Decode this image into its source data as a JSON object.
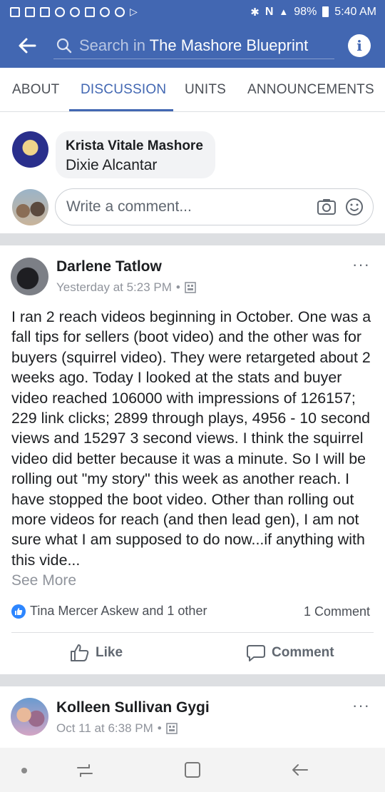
{
  "status_bar": {
    "battery": "98%",
    "time": "5:40 AM"
  },
  "header": {
    "search_prefix": "Search in",
    "group_name": "The Mashore Blueprint",
    "info_label": "i"
  },
  "tabs": [
    {
      "label": "ABOUT"
    },
    {
      "label": "DISCUSSION",
      "active": true
    },
    {
      "label": "UNITS"
    },
    {
      "label": "ANNOUNCEMENTS"
    }
  ],
  "top_comment": {
    "author": "Krista Vitale Mashore",
    "text": "Dixie Alcantar"
  },
  "comment_input": {
    "placeholder": "Write a comment..."
  },
  "post": {
    "author": "Darlene Tatlow",
    "time": "Yesterday at 5:23 PM",
    "more": "···",
    "body": "I ran 2 reach videos beginning in October.  One was a fall tips for sellers (boot video) and the other was for buyers (squirrel video).  They were retargeted about 2 weeks ago.  Today I looked at the stats and buyer video reached 106000 with impressions of 126157; 229 link clicks; 2899 through plays, 4956  - 10 second views and 15297 3 second views. I think the squirrel video did better because it was a minute.  So I will be rolling out \"my story\" this week as another reach.  I have stopped the boot video.  Other than rolling out more videos for reach (and then lead gen), I am not sure what I am supposed to do now...if anything with this vide...",
    "see_more": "See More",
    "reactions": "Tina Mercer Askew and 1 other",
    "comment_count": "1 Comment",
    "like_label": "Like",
    "comment_label": "Comment"
  },
  "post2": {
    "author": "Kolleen Sullivan Gygi",
    "time": "Oct 11 at 6:38 PM",
    "more": "···"
  },
  "colors": {
    "brand": "#4267b2",
    "like_blue": "#2d86ff"
  }
}
